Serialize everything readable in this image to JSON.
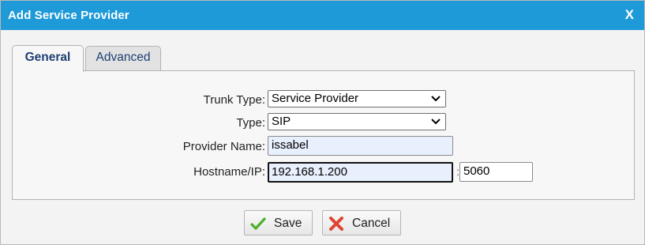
{
  "dialog": {
    "title": "Add Service Provider",
    "close_label": "X"
  },
  "tabs": [
    {
      "label": "General",
      "active": true
    },
    {
      "label": "Advanced",
      "active": false
    }
  ],
  "form": {
    "trunk_type": {
      "label": "Trunk Type:",
      "value": "Service Provider"
    },
    "type": {
      "label": "Type:",
      "value": "SIP"
    },
    "provider_name": {
      "label": "Provider Name:",
      "value": "issabel"
    },
    "hostname": {
      "label": "Hostname/IP:",
      "value": "192.168.1.200",
      "port_separator": ":",
      "port": "5060"
    }
  },
  "buttons": {
    "save_label": "Save",
    "cancel_label": "Cancel"
  },
  "colors": {
    "titlebar": "#1e9ad9",
    "tab_text": "#1f3f73",
    "save_icon": "#4caf2a",
    "cancel_icon": "#e0432f"
  },
  "icons": {
    "close": "close-icon",
    "dropdown": "chevron-down-icon",
    "save": "checkmark-icon",
    "cancel": "cross-icon"
  }
}
